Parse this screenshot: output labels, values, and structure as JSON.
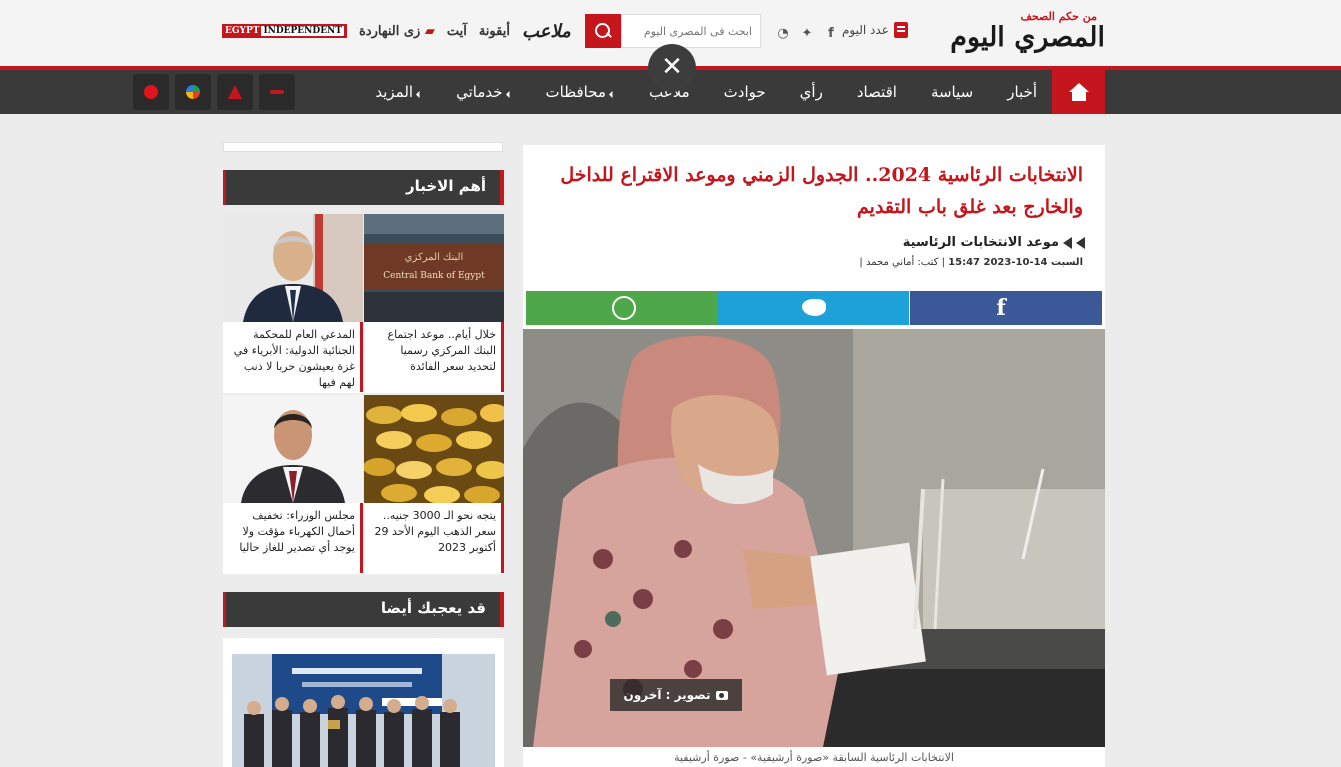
{
  "header": {
    "logo_small": "من حكم الصحف",
    "logo_main": "المصري اليوم",
    "issue_label": "عدد اليوم",
    "social_icons": [
      "facebook-icon",
      "twitter-icon",
      "rss-icon"
    ],
    "search_placeholder": "ابحث فى المصرى اليوم",
    "partners": {
      "mal3ab": "ملاعب",
      "ayqona": "أيقونة",
      "ayeh": "آيت",
      "zay": "زى النهاردة",
      "ei_egypt": "EGYPT",
      "ei_independent": "INDEPENDENT"
    }
  },
  "nav": {
    "items": [
      {
        "label": "أخبار",
        "dropdown": false
      },
      {
        "label": "سياسة",
        "dropdown": false
      },
      {
        "label": "اقتصاد",
        "dropdown": false
      },
      {
        "label": "رأي",
        "dropdown": false
      },
      {
        "label": "حوادث",
        "dropdown": false
      },
      {
        "label": "ملاعب",
        "dropdown": false
      },
      {
        "label": "محافظات",
        "dropdown": true
      },
      {
        "label": "خدماتي",
        "dropdown": true
      },
      {
        "label": "المزيد",
        "dropdown": true
      }
    ],
    "close_glyph": "✕"
  },
  "article": {
    "title": "الانتخابات الرئاسية 2024.. الجدول الزمني وموعد الاقتراع للداخل والخارج بعد غلق باب التقديم",
    "kicker": "موعد الانتخابات الرئاسية",
    "date": "السبت 14-10-2023 15:47",
    "author": "كتب: أماني محمد",
    "photo_credit": "تصوير : آخرون",
    "caption": "الانتخابات الرئاسية السابقة «صورة أرشيفية» - صورة أرشيفية",
    "share_facebook_glyph": "f"
  },
  "sidebar": {
    "top_news_title": "أهم الاخبار",
    "top_news": [
      "خلال أيام.. موعد اجتماع البنك المركزي رسميا لتحديد سعر الفائدة",
      "المدعي العام للمحكمة الجنائية الدولية: الأبرياء في غزة يعيشون حربا لا ذنب لهم فيها",
      "يتجه نحو الـ 3000 جنيه.. سعر الذهب اليوم الأحد 29 أكتوبر 2023",
      "مجلس الوزراء: تخفيف أحمال الكهرباء مؤقت ولا يوجد أي تصدير للغاز حاليا"
    ],
    "bank_sign": "Central Bank of Egypt",
    "might_like_title": "قد يعجبك أيضا"
  },
  "colors": {
    "brand_red": "#c4161c",
    "nav_dark": "#3a3a3a",
    "whatsapp": "#4ea84a",
    "twitter": "#1da1d8",
    "facebook": "#3b5998"
  }
}
